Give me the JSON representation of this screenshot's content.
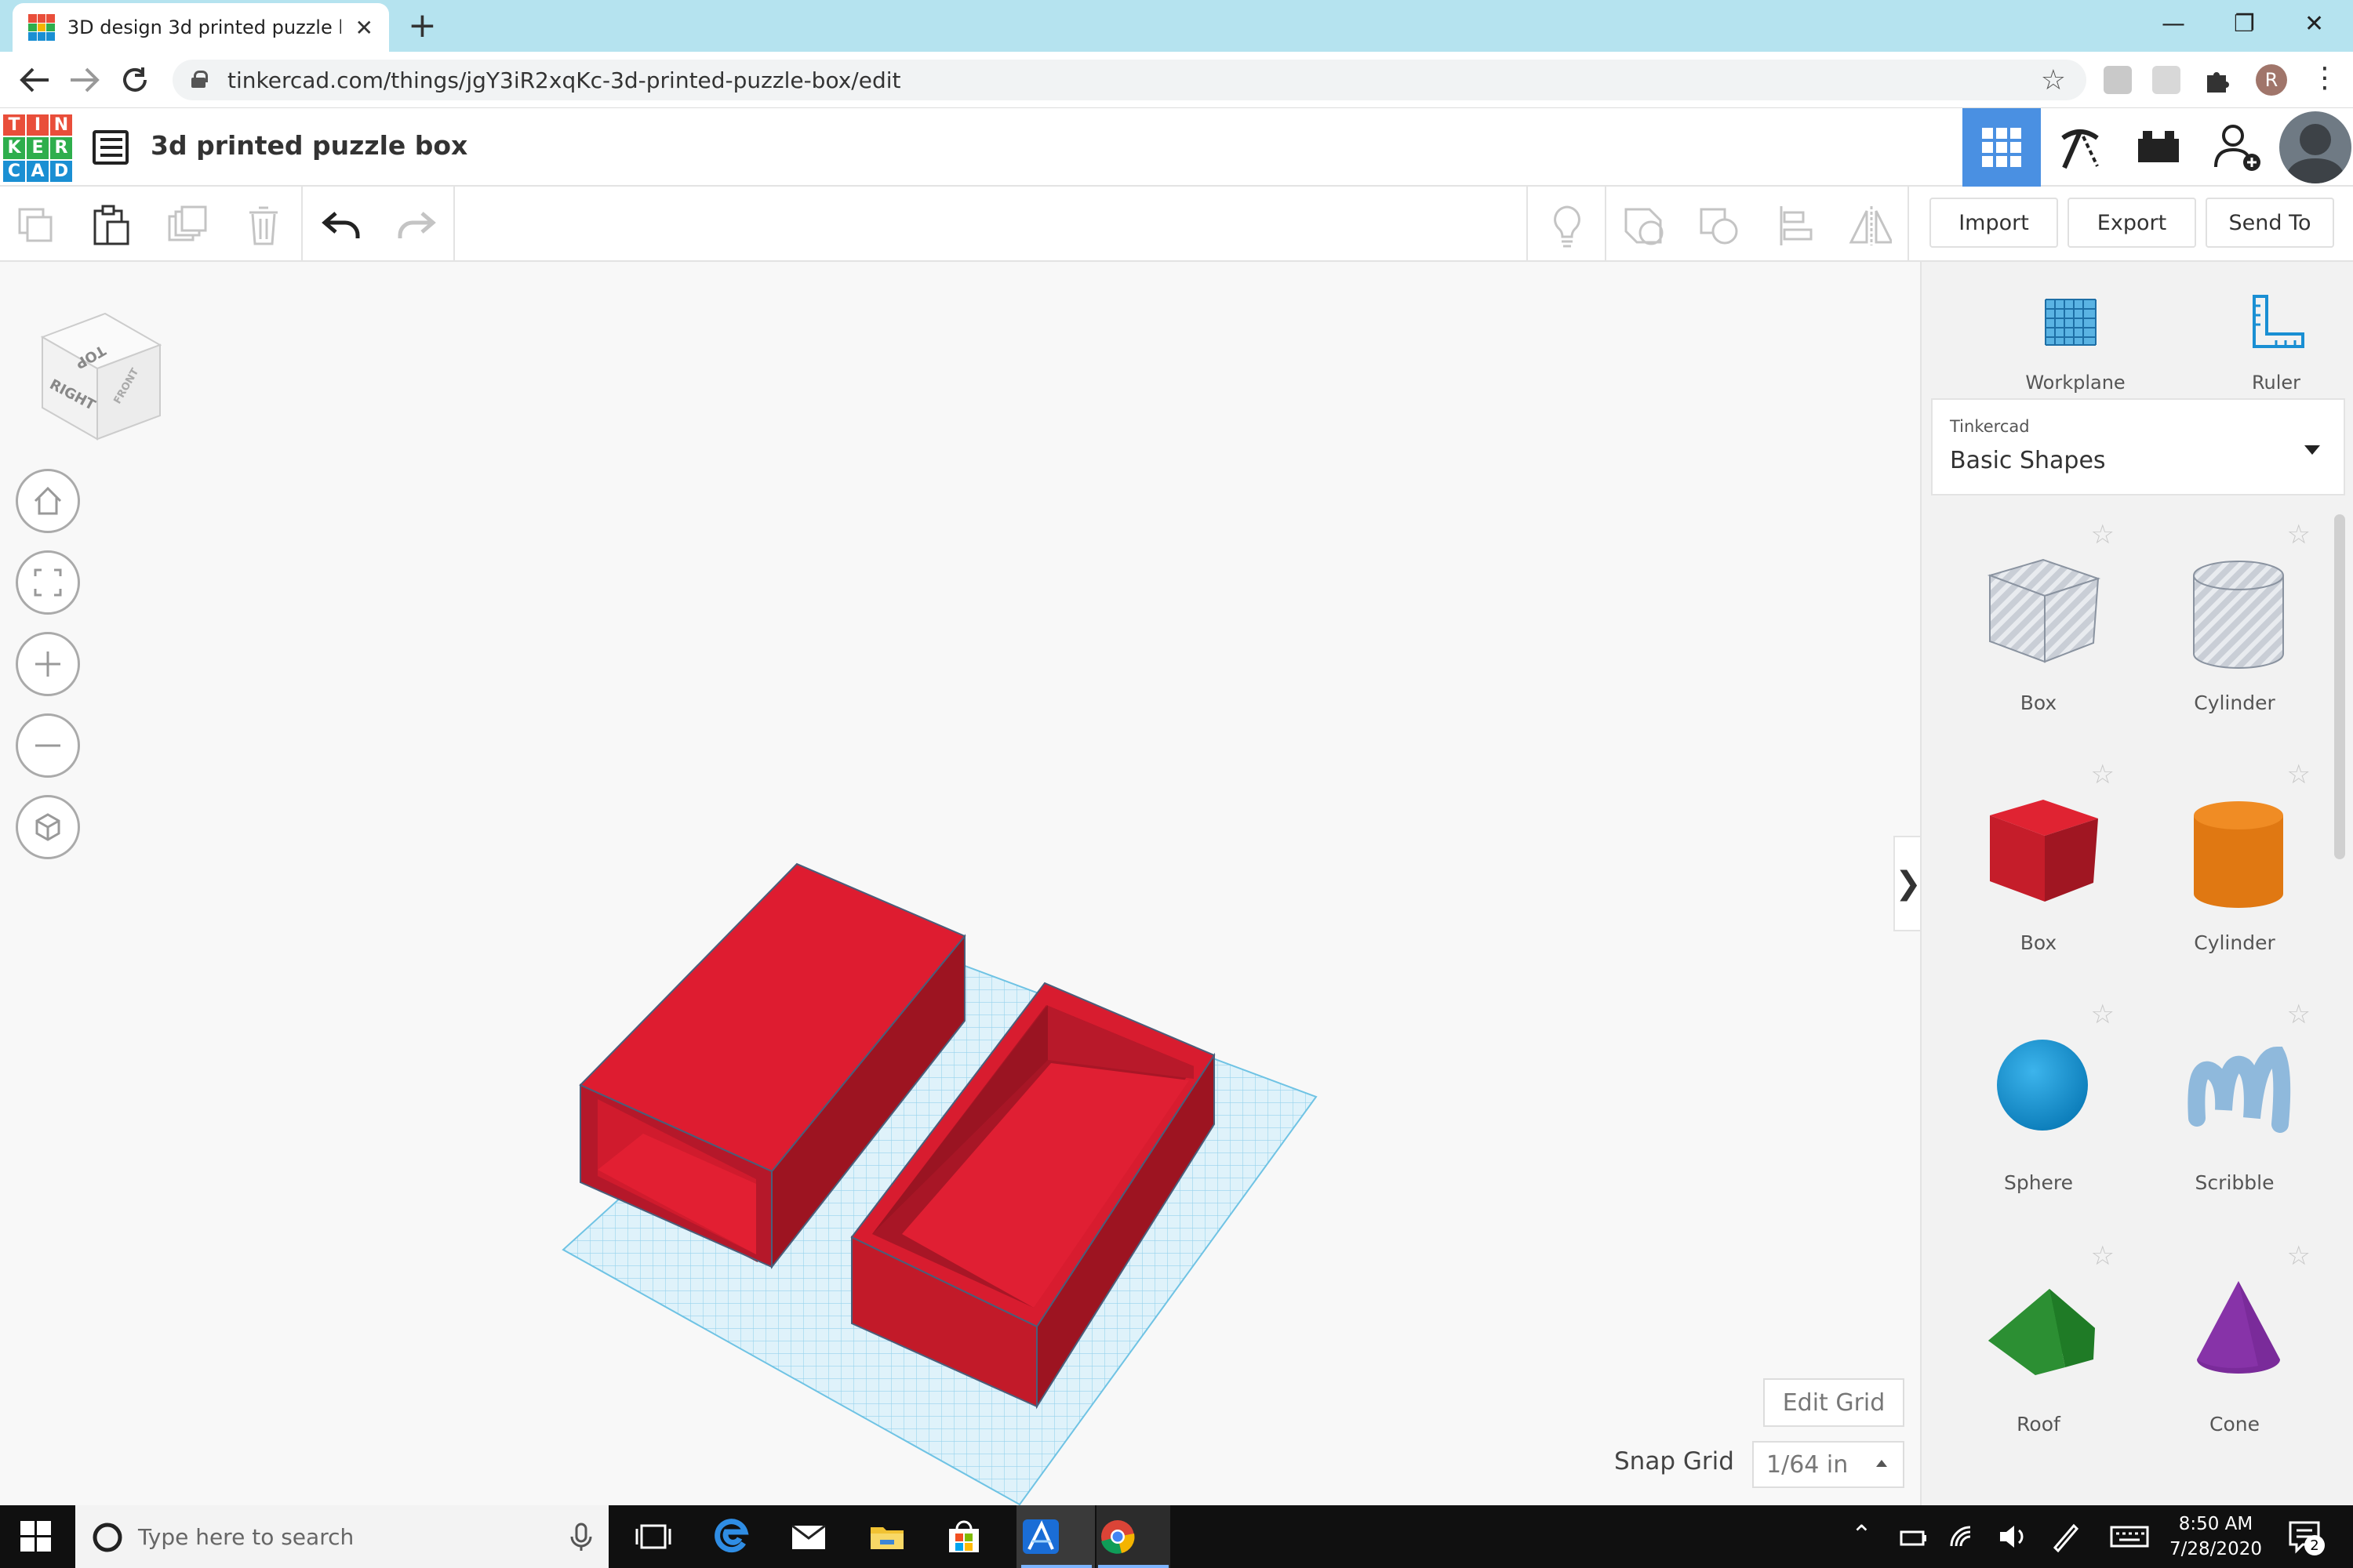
{
  "browser": {
    "tab_title": "3D design 3d printed puzzle box",
    "tab_close": "✕",
    "new_tab": "+",
    "url": "tinkercad.com/things/jgY3iR2xqKc-3d-printed-puzzle-box/edit",
    "profile_initial": "R",
    "window_controls": [
      "—",
      "❐",
      "✕"
    ]
  },
  "app": {
    "logo_letters": [
      "T",
      "I",
      "N",
      "K",
      "E",
      "R",
      "C",
      "A",
      "D"
    ],
    "logo_colors": [
      "#e94e3a",
      "#e94e3a",
      "#e94e3a",
      "#2eae4c",
      "#2eae4c",
      "#2eae4c",
      "#1a8fd3",
      "#1a8fd3",
      "#1a8fd3"
    ],
    "project_title": "3d printed puzzle box",
    "accent_color": "#4a90e2"
  },
  "edit_toolbar": {
    "import_label": "Import",
    "export_label": "Export",
    "sendto_label": "Send To"
  },
  "canvas": {
    "viewcube": {
      "top": "TOP",
      "right": "RIGHT",
      "front": "FRONT"
    },
    "edit_grid_label": "Edit Grid",
    "snap_grid_label": "Snap Grid",
    "snap_grid_value": "1/64 in",
    "collapse_glyph": "❯"
  },
  "panel": {
    "workplane_label": "Workplane",
    "ruler_label": "Ruler",
    "library_subtitle": "Tinkercad",
    "library_name": "Basic Shapes",
    "shapes": [
      {
        "label": "Box",
        "kind": "box-hole"
      },
      {
        "label": "Cylinder",
        "kind": "cylinder-hole"
      },
      {
        "label": "Box",
        "kind": "box"
      },
      {
        "label": "Cylinder",
        "kind": "cylinder"
      },
      {
        "label": "Sphere",
        "kind": "sphere"
      },
      {
        "label": "Scribble",
        "kind": "scribble"
      },
      {
        "label": "Roof",
        "kind": "roof"
      },
      {
        "label": "Cone",
        "kind": "cone"
      }
    ]
  },
  "taskbar": {
    "search_placeholder": "Type here to search",
    "time": "8:50 AM",
    "date": "7/28/2020",
    "notification_count": "2"
  }
}
